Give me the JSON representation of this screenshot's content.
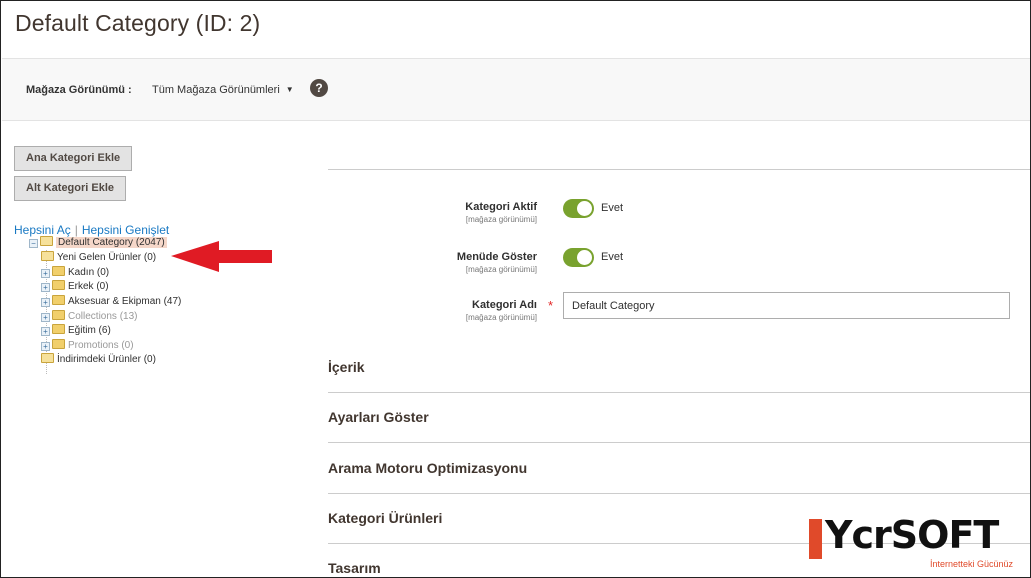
{
  "page": {
    "title": "Default Category (ID: 2)"
  },
  "store_view": {
    "label": "Mağaza Görünümü :",
    "selected": "Tüm Mağaza Görünümleri",
    "help": "?"
  },
  "buttons": {
    "add_root": "Ana Kategori Ekle",
    "add_sub": "Alt Kategori Ekle"
  },
  "tree_links": {
    "collapse_all": "Hepsini Aç",
    "separator": "|",
    "expand_all": "Hepsini Genişlet"
  },
  "tree": {
    "root": {
      "label": "Default Category (2047)",
      "expander": "−"
    },
    "children": [
      {
        "label": "Yeni Gelen Ürünler (0)",
        "expander": "",
        "dim": false
      },
      {
        "label": "Kadın (0)",
        "expander": "+",
        "dim": false
      },
      {
        "label": "Erkek (0)",
        "expander": "+",
        "dim": false
      },
      {
        "label": "Aksesuar & Ekipman (47)",
        "expander": "+",
        "dim": false
      },
      {
        "label": "Collections (13)",
        "expander": "+",
        "dim": true
      },
      {
        "label": "Eğitim (6)",
        "expander": "+",
        "dim": false
      },
      {
        "label": "Promotions (0)",
        "expander": "+",
        "dim": true
      },
      {
        "label": "İndirimdeki Ürünler (0)",
        "expander": "",
        "dim": false
      }
    ]
  },
  "form": {
    "active": {
      "label": "Kategori Aktif",
      "scope": "[mağaza görünümü]",
      "value": "Evet",
      "on": true
    },
    "menu": {
      "label": "Menüde Göster",
      "scope": "[mağaza görünümü]",
      "value": "Evet",
      "on": true
    },
    "name": {
      "label": "Kategori Adı",
      "scope": "[mağaza görünümü]",
      "required_mark": "*",
      "value": "Default Category"
    }
  },
  "sections": [
    "İçerik",
    "Ayarları Göster",
    "Arama Motoru Optimizasyonu",
    "Kategori Ürünleri",
    "Tasarım"
  ],
  "watermark": {
    "word": "YcrSOFT",
    "tagline": "İnternetteki Gücünüz"
  },
  "colors": {
    "toggle_on": "#79a22e",
    "selected_node": "#f5d7c9",
    "arrow": "#e01b24",
    "brand": "#e04a2a",
    "link": "#1979c3"
  }
}
